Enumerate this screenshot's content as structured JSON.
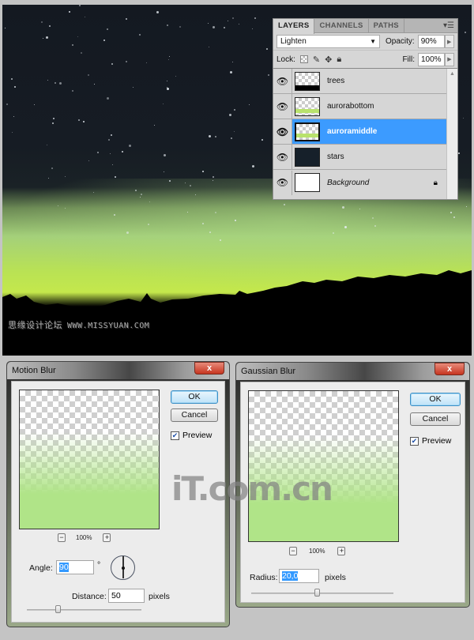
{
  "canvas": {
    "watermark_cn": "思缘设计论坛",
    "watermark_url": "WWW.MISSYUAN.COM"
  },
  "layers_panel": {
    "tabs": [
      {
        "label": "LAYERS",
        "active": true
      },
      {
        "label": "CHANNELS",
        "active": false
      },
      {
        "label": "PATHS",
        "active": false
      }
    ],
    "menu_icon": "panel-menu-icon",
    "blend_mode": "Lighten",
    "opacity_label": "Opacity:",
    "opacity_value": "90%",
    "lock_label": "Lock:",
    "lock_icons": [
      "lock-transparent-pixels-icon",
      "lock-image-pixels-icon",
      "lock-position-icon",
      "lock-all-icon"
    ],
    "fill_label": "Fill:",
    "fill_value": "100%",
    "layers": [
      {
        "name": "trees",
        "visible": true,
        "selected": false
      },
      {
        "name": "aurorabottom",
        "visible": true,
        "selected": false
      },
      {
        "name": "auroramiddle",
        "visible": true,
        "selected": true
      },
      {
        "name": "stars",
        "visible": true,
        "selected": false
      },
      {
        "name": "Background",
        "visible": true,
        "selected": false,
        "locked": true
      }
    ]
  },
  "motion_blur": {
    "title": "Motion Blur",
    "close_label": "x",
    "ok_label": "OK",
    "cancel_label": "Cancel",
    "preview_label": "Preview",
    "preview_checked": true,
    "zoom_minus": "−",
    "zoom_plus": "+",
    "zoom_level": "100%",
    "angle_label": "Angle:",
    "angle_value": "90",
    "angle_unit": "°",
    "distance_label": "Distance:",
    "distance_value": "50",
    "distance_unit": "pixels",
    "distance_slider_fraction": 0.27
  },
  "gaussian_blur": {
    "title": "Gaussian Blur",
    "close_label": "x",
    "ok_label": "OK",
    "cancel_label": "Cancel",
    "preview_label": "Preview",
    "preview_checked": true,
    "zoom_minus": "−",
    "zoom_plus": "+",
    "zoom_level": "100%",
    "radius_label": "Radius:",
    "radius_value": "20,0",
    "radius_unit": "pixels",
    "radius_slider_fraction": 0.46
  },
  "watermark_itcom": "iT.com.cn"
}
